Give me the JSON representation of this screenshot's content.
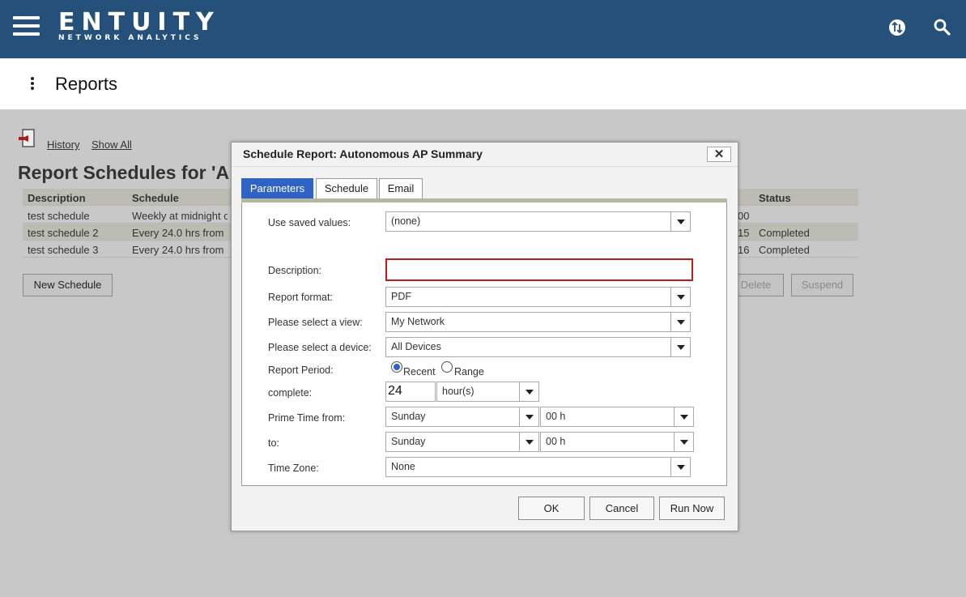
{
  "header": {
    "brand": "ENTUITY",
    "brand_sub": "NETWORK ANALYTICS",
    "sync_icon": "sync-icon",
    "search_icon": "search-icon"
  },
  "titlebar": {
    "title": "Reports"
  },
  "background": {
    "links": {
      "history": "History",
      "show_all": "Show All"
    },
    "heading": "Report Schedules for 'Autonomous AP Summary'",
    "table": {
      "columns": {
        "description": "Description",
        "schedule": "Schedule",
        "status": "Status"
      },
      "rows": [
        {
          "description": "test schedule",
          "schedule": "Weekly at midnight on",
          "time_frag": "00",
          "status": ""
        },
        {
          "description": "test schedule 2",
          "schedule": "Every 24.0 hrs from",
          "time_frag": "15",
          "status": "Completed"
        },
        {
          "description": "test schedule 3",
          "schedule": "Every 24.0 hrs from",
          "time_frag": "16",
          "status": "Completed"
        }
      ]
    },
    "buttons": {
      "new_schedule": "New Schedule",
      "delete": "Delete",
      "suspend": "Suspend"
    }
  },
  "dialog": {
    "title": "Schedule Report: Autonomous AP Summary",
    "close": "✕",
    "tabs": {
      "parameters": "Parameters",
      "schedule": "Schedule",
      "email": "Email"
    },
    "fields": {
      "saved_values": {
        "label": "Use saved values:",
        "value": "(none)"
      },
      "description": {
        "label": "Description:",
        "value": ""
      },
      "format": {
        "label": "Report format:",
        "value": "PDF"
      },
      "view": {
        "label": "Please select a view:",
        "value": "My Network"
      },
      "device": {
        "label": "Please select a device:",
        "value": "All Devices"
      },
      "period": {
        "label": "Report Period:",
        "recent": "Recent",
        "range": "Range",
        "selected": "Recent"
      },
      "complete": {
        "label": "complete:",
        "value": "24",
        "unit": "hour(s)"
      },
      "prime_from": {
        "label": "Prime Time from:",
        "day": "Sunday",
        "hour": "00 h"
      },
      "prime_to": {
        "label": "to:",
        "day": "Sunday",
        "hour": "00 h"
      },
      "timezone": {
        "label": "Time Zone:",
        "value": "None"
      }
    },
    "buttons": {
      "ok": "OK",
      "cancel": "Cancel",
      "run_now": "Run Now"
    }
  }
}
